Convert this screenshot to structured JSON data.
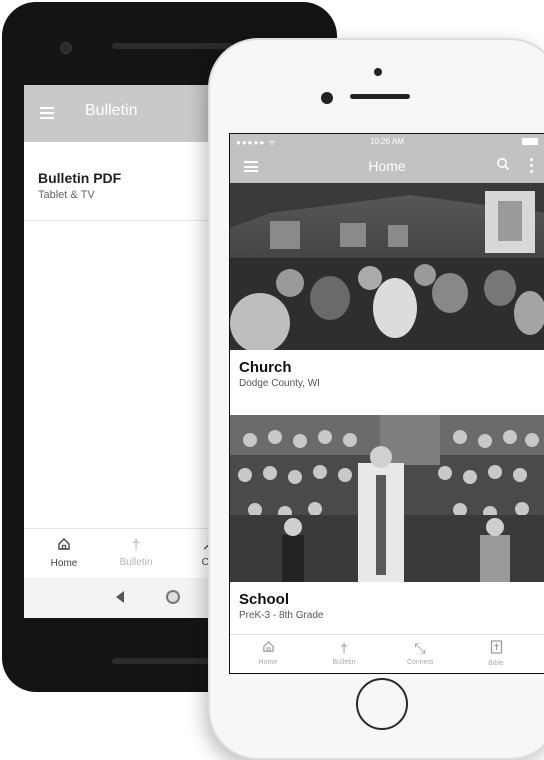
{
  "android": {
    "appbar_title": "Bulletin",
    "list_item": {
      "title": "Bulletin PDF",
      "subtitle": "Tablet & TV"
    },
    "bottom_nav": [
      {
        "label": "Home",
        "icon": "home-icon"
      },
      {
        "label": "Bulletin",
        "icon": "cross-icon"
      },
      {
        "label": "Co",
        "icon": "connect-icon"
      }
    ],
    "system_nav": {
      "back": "back-icon",
      "home": "home-circle-icon"
    }
  },
  "iphone": {
    "status_bar": {
      "signal": "●●●●● ᯤ",
      "time": "10:26 AM"
    },
    "appbar_title": "Home",
    "cards": [
      {
        "title": "Church",
        "subtitle": "Dodge County, WI",
        "image": "church-interior-photo"
      },
      {
        "title": "School",
        "subtitle": "PreK-3 - 8th Grade",
        "image": "school-group-photo"
      }
    ],
    "bottom_nav": [
      {
        "label": "Home",
        "icon": "home-icon"
      },
      {
        "label": "Bulletin",
        "icon": "cross-icon"
      },
      {
        "label": "Connect",
        "icon": "connect-icon"
      },
      {
        "label": "Bible",
        "icon": "bible-icon"
      }
    ]
  },
  "colors": {
    "appbar": "#c2c2c2",
    "android_appbar": "#c9c9c9",
    "android_body": "#141414"
  }
}
